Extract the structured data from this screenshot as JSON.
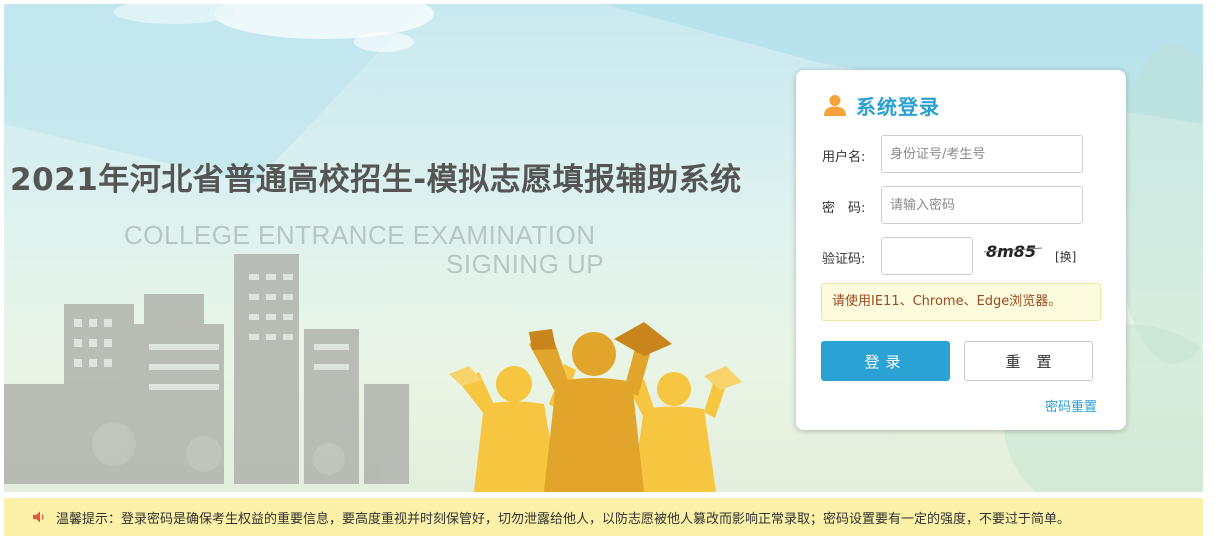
{
  "banner": {
    "title": "2021年河北省普通高校招生-模拟志愿填报辅助系统",
    "subtitle_line1": "COLLEGE ENTRANCE EXAMINATION",
    "subtitle_line2": "SIGNING UP",
    "decor_icons": [
      "city-skyline-icon",
      "graduates-celebrating-icon"
    ]
  },
  "login": {
    "header_icon": "user-icon",
    "title": "系统登录",
    "username_label": "用户名:",
    "username_placeholder": "身份证号/考生号",
    "password_label": "密　码:",
    "password_placeholder": "请输入密码",
    "captcha_label": "验证码:",
    "captcha_value": "",
    "captcha_text": "8m85",
    "refresh_label": "[换]",
    "browser_notice": "请使用IE11、Chrome、Edge浏览器。",
    "login_button": "登录",
    "reset_button": "重置",
    "password_reset_link": "密码重置"
  },
  "tips": {
    "icon": "speaker-icon",
    "label": "温馨提示：",
    "text": "登录密码是确保考生权益的重要信息，要高度重视并时刻保管好，切勿泄露给他人，以防志愿被他人篡改而影响正常录取；密码设置要有一定的强度，不要过于简单。"
  },
  "colors": {
    "accent": "#2aa3d4",
    "title_text": "#555553",
    "notice_bg": "#fcfbdd",
    "notice_text": "#9b4a20",
    "tips_bg": "#fbf0a8",
    "graduate_gold": "#f5c43a",
    "graduate_dark": "#d49a1c"
  }
}
